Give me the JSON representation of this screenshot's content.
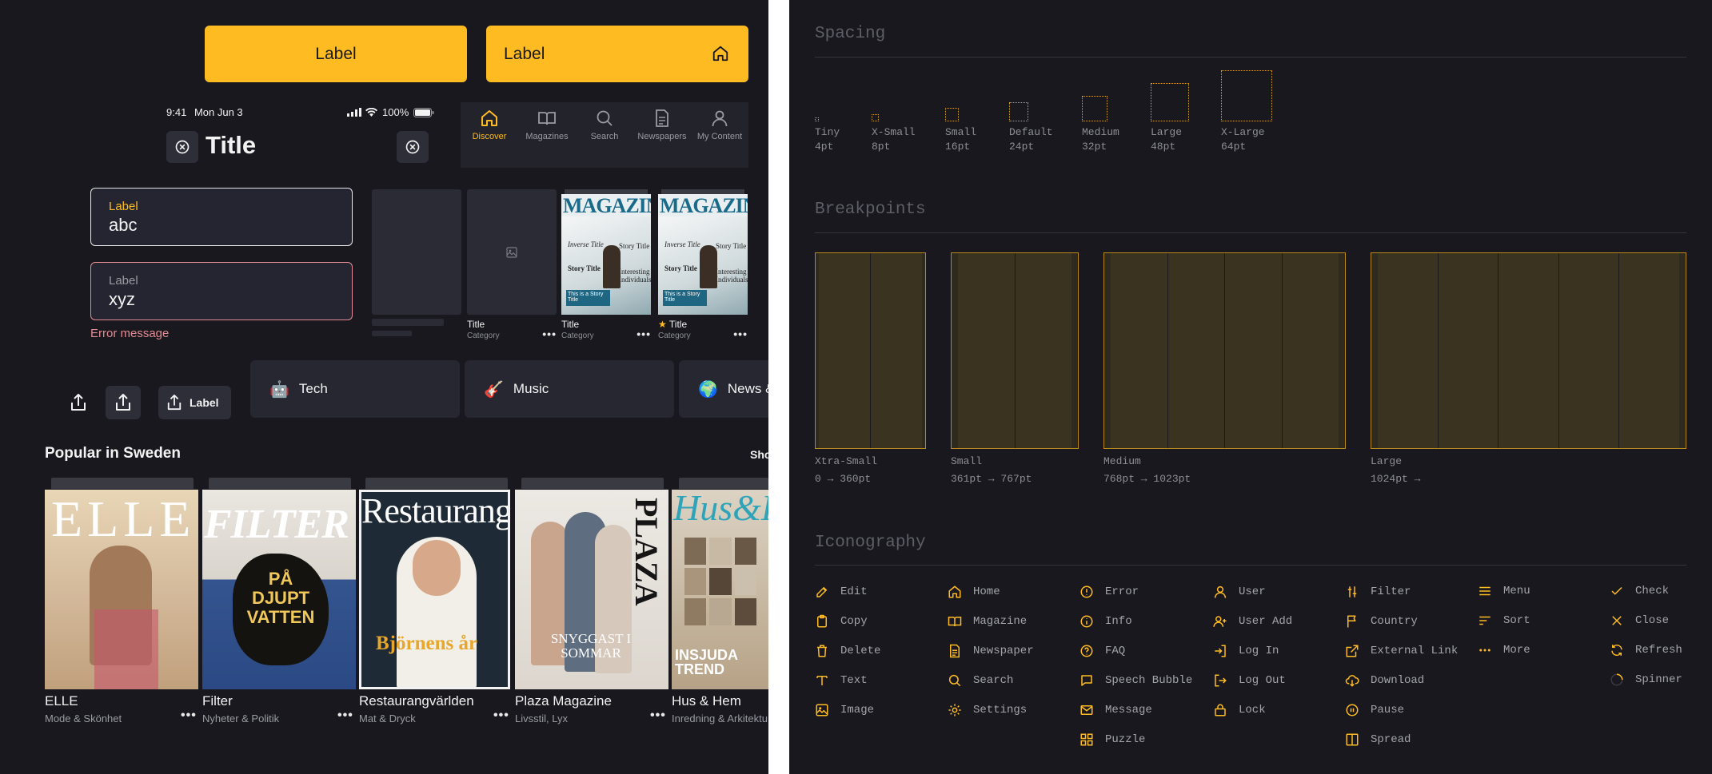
{
  "buttons": {
    "label_wide": "Label",
    "label_icon": "Label",
    "share_label": "Label"
  },
  "status_bar": {
    "time": "9:41",
    "date": "Mon Jun 3",
    "battery": "100%"
  },
  "nav": {
    "title": "Title"
  },
  "tabs": [
    {
      "label": "Discover",
      "icon": "home-icon",
      "active": true
    },
    {
      "label": "Magazines",
      "icon": "book-icon",
      "active": false
    },
    {
      "label": "Search",
      "icon": "search-icon",
      "active": false
    },
    {
      "label": "Newspapers",
      "icon": "newspaper-icon",
      "active": false
    },
    {
      "label": "My Content",
      "icon": "user-icon",
      "active": false
    }
  ],
  "fields": [
    {
      "label": "Label",
      "value": "abc",
      "state": "focused"
    },
    {
      "label": "Label",
      "value": "xyz",
      "state": "error",
      "error": "Error message"
    }
  ],
  "cards": [
    {
      "title": "",
      "category": ""
    },
    {
      "title": "Title",
      "category": "Category"
    },
    {
      "title": "Title",
      "category": "Category",
      "masthead": "MAGAZINE",
      "lines": [
        "Inverse Title",
        "Story Title",
        "Story Title",
        "Interesting Individuals",
        "This is a Story Title"
      ]
    },
    {
      "title": "Title",
      "category": "Category",
      "masthead": "MAGAZINE",
      "starred": true,
      "lines": [
        "Inverse Title",
        "Story Title",
        "Story Title",
        "Interesting Individuals",
        "This is a Story Title"
      ]
    }
  ],
  "chips": [
    {
      "emoji": "🤖",
      "label": "Tech"
    },
    {
      "emoji": "🎸",
      "label": "Music"
    },
    {
      "emoji": "🌍",
      "label": "News &"
    }
  ],
  "popular": {
    "heading": "Popular in Sweden",
    "show_all": "Sho",
    "items": [
      {
        "title": "ELLE",
        "subtitle": "Mode & Skönhet",
        "masthead": "ELLE",
        "color": "#d9c7a8"
      },
      {
        "title": "Filter",
        "subtitle": "Nyheter & Politik",
        "masthead": "FILTER",
        "cover_text": "PÅ DJUPT VATTEN",
        "color": "#2c4d8a"
      },
      {
        "title": "Restaurangvärlden",
        "subtitle": "Mat & Dryck",
        "masthead": "Restaurang",
        "cover_text": "Björnens år",
        "color": "#1f2e3a"
      },
      {
        "title": "Plaza Magazine",
        "subtitle": "Livsstil, Lyx",
        "masthead": "PLAZA",
        "cover_text": "SNYGGAST I SOMMAR",
        "color": "#e8e4df"
      },
      {
        "title": "Hus & Hem",
        "subtitle": "Inredning & Arkitektu",
        "masthead": "Hus&H",
        "cover_text": "INSJUDA TREND",
        "color": "#b7a48a"
      }
    ]
  },
  "spacing": {
    "heading": "Spacing",
    "items": [
      {
        "name": "Tiny",
        "value": "4pt"
      },
      {
        "name": "X-Small",
        "value": "8pt"
      },
      {
        "name": "Small",
        "value": "16pt"
      },
      {
        "name": "Default",
        "value": "24pt"
      },
      {
        "name": "Medium",
        "value": "32pt"
      },
      {
        "name": "Large",
        "value": "48pt"
      },
      {
        "name": "X-Large",
        "value": "64pt"
      }
    ]
  },
  "breakpoints": {
    "heading": "Breakpoints",
    "items": [
      {
        "name": "Xtra-Small",
        "range": "0 → 360pt",
        "columns": 2
      },
      {
        "name": "Small",
        "range": "361pt → 767pt",
        "columns": 2
      },
      {
        "name": "Medium",
        "range": "768pt → 1023pt",
        "columns": 4
      },
      {
        "name": "Large",
        "range": "1024pt →",
        "columns": 5
      }
    ]
  },
  "iconography": {
    "heading": "Iconography",
    "columns": [
      [
        "Edit",
        "Copy",
        "Delete",
        "Text",
        "Image"
      ],
      [
        "Home",
        "Magazine",
        "Newspaper",
        "Search",
        "Settings"
      ],
      [
        "Error",
        "Info",
        "FAQ",
        "Speech Bubble",
        "Message",
        "Puzzle"
      ],
      [
        "User",
        "User Add",
        "Log In",
        "Log Out",
        "Lock"
      ],
      [
        "Filter",
        "Country",
        "External Link",
        "Download",
        "Pause",
        "Spread"
      ],
      [
        "Menu",
        "Sort",
        "More"
      ],
      [
        "Check",
        "Close",
        "Refresh",
        "Spinner"
      ]
    ]
  },
  "colors": {
    "accent": "#ffbc22",
    "background": "#18181e",
    "surface": "#242530",
    "error": "#e58b93",
    "border_focus": "#e8e8e8"
  }
}
